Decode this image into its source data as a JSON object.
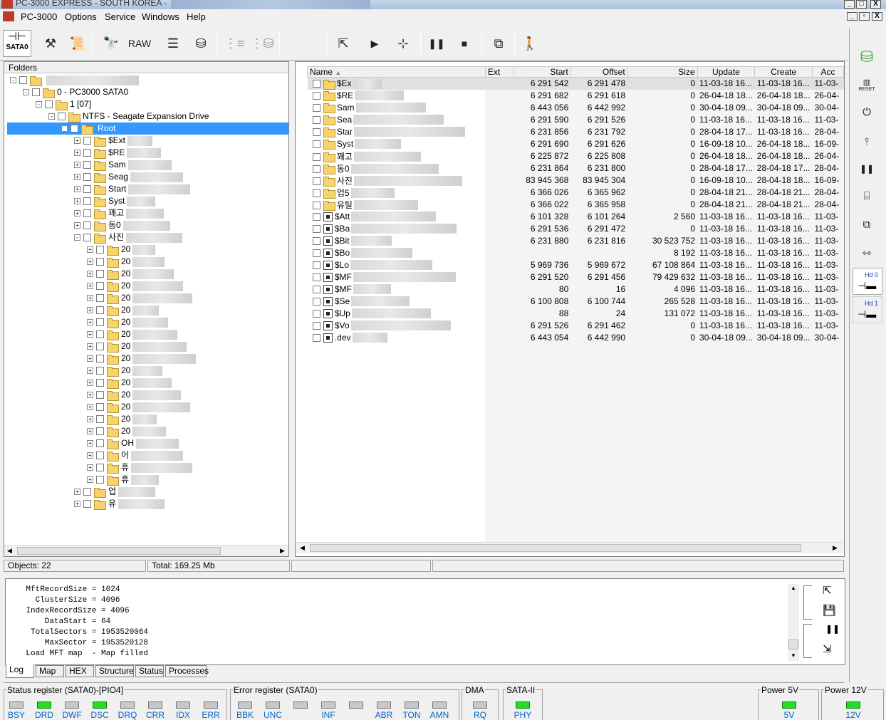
{
  "window": {
    "title": "PC-3000 EXPRESS - SOUTH KOREA -",
    "btn_min": "_",
    "btn_max": "□",
    "btn_close": "X",
    "child_min": "_",
    "child_restore": "▫",
    "child_close": "X"
  },
  "menu": [
    "PC-3000",
    "Options",
    "Service",
    "Windows",
    "Help"
  ],
  "toolbar": {
    "port_label": "SATA0",
    "raw_label": "RAW"
  },
  "folders": {
    "header": "Folders",
    "rows": [
      {
        "label": "",
        "level": 0,
        "exp": "-"
      },
      {
        "label": "0 - PC3000 SATA0",
        "level": 1,
        "exp": "-"
      },
      {
        "label": "1 [07]",
        "level": 2,
        "exp": "-"
      },
      {
        "label": "NTFS - Seagate Expansion Drive",
        "level": 3,
        "exp": "-"
      },
      {
        "label": "Root",
        "level": 4,
        "exp": "-"
      },
      {
        "label": "$Ext",
        "level": 5,
        "exp": "+"
      },
      {
        "label": "$RE",
        "level": 5,
        "exp": "+"
      },
      {
        "label": "Sam",
        "level": 5,
        "exp": "+"
      },
      {
        "label": "Seag",
        "level": 5,
        "exp": "+"
      },
      {
        "label": "Start",
        "level": 5,
        "exp": "+"
      },
      {
        "label": "Syst",
        "level": 5,
        "exp": "+"
      },
      {
        "label": "꽤고",
        "level": 5,
        "exp": "+"
      },
      {
        "label": "동0",
        "level": 5,
        "exp": "+"
      },
      {
        "label": "사진",
        "level": 5,
        "exp": "-"
      },
      {
        "label": "20",
        "level": 6,
        "exp": "+"
      },
      {
        "label": "20",
        "level": 6,
        "exp": "+"
      },
      {
        "label": "20",
        "level": 6,
        "exp": "+"
      },
      {
        "label": "20",
        "level": 6,
        "exp": "+"
      },
      {
        "label": "20",
        "level": 6,
        "exp": "+"
      },
      {
        "label": "20",
        "level": 6,
        "exp": "+"
      },
      {
        "label": "20",
        "level": 6,
        "exp": "+"
      },
      {
        "label": "20",
        "level": 6,
        "exp": "+"
      },
      {
        "label": "20",
        "level": 6,
        "exp": "+"
      },
      {
        "label": "20",
        "level": 6,
        "exp": "+"
      },
      {
        "label": "20",
        "level": 6,
        "exp": "+"
      },
      {
        "label": "20",
        "level": 6,
        "exp": "+"
      },
      {
        "label": "20",
        "level": 6,
        "exp": "+"
      },
      {
        "label": "20",
        "level": 6,
        "exp": "+"
      },
      {
        "label": "20",
        "level": 6,
        "exp": "+"
      },
      {
        "label": "20",
        "level": 6,
        "exp": "+"
      },
      {
        "label": "OH",
        "level": 6,
        "exp": "+"
      },
      {
        "label": "어",
        "level": 6,
        "exp": "+"
      },
      {
        "label": "휴",
        "level": 6,
        "exp": "+"
      },
      {
        "label": "휴",
        "level": 6,
        "exp": "+"
      },
      {
        "label": "업",
        "level": 5,
        "exp": "+"
      },
      {
        "label": "유",
        "level": 5,
        "exp": "+"
      }
    ]
  },
  "files": {
    "columns": [
      "Name",
      "Ext",
      "Start",
      "Offset",
      "Size",
      "Update",
      "Create",
      "Acc"
    ],
    "rows": [
      {
        "name": "$Ex",
        "type": "folder",
        "start": "6 291 542",
        "offset": "6 291 478",
        "size": "0",
        "update": "11-03-18 16...",
        "create": "11-03-18 16...",
        "acc": "11-03-"
      },
      {
        "name": "$RE",
        "type": "folder",
        "start": "6 291 682",
        "offset": "6 291 618",
        "size": "0",
        "update": "26-04-18 18...",
        "create": "26-04-18 18...",
        "acc": "26-04-"
      },
      {
        "name": "Sam",
        "type": "folder",
        "start": "6 443 056",
        "offset": "6 442 992",
        "size": "0",
        "update": "30-04-18 09...",
        "create": "30-04-18 09...",
        "acc": "30-04-"
      },
      {
        "name": "Sea",
        "type": "folder",
        "start": "6 291 590",
        "offset": "6 291 526",
        "size": "0",
        "update": "11-03-18 16...",
        "create": "11-03-18 16...",
        "acc": "11-03-"
      },
      {
        "name": "Star",
        "type": "folder",
        "start": "6 231 856",
        "offset": "6 231 792",
        "size": "0",
        "update": "28-04-18 17...",
        "create": "11-03-18 16...",
        "acc": "28-04-"
      },
      {
        "name": "Syst",
        "type": "folder",
        "start": "6 291 690",
        "offset": "6 291 626",
        "size": "0",
        "update": "16-09-18 10...",
        "create": "26-04-18 18...",
        "acc": "16-09-"
      },
      {
        "name": "꽤고",
        "type": "folder",
        "start": "6 225 872",
        "offset": "6 225 808",
        "size": "0",
        "update": "26-04-18 18...",
        "create": "26-04-18 18...",
        "acc": "26-04-"
      },
      {
        "name": "동0",
        "type": "folder",
        "start": "6 231 864",
        "offset": "6 231 800",
        "size": "0",
        "update": "28-04-18 17...",
        "create": "28-04-18 17...",
        "acc": "28-04-"
      },
      {
        "name": "사진",
        "type": "folder",
        "start": "83 945 368",
        "offset": "83 945 304",
        "size": "0",
        "update": "16-09-18 10...",
        "create": "28-04-18 18...",
        "acc": "16-09-"
      },
      {
        "name": "업5",
        "type": "folder",
        "start": "6 366 026",
        "offset": "6 365 962",
        "size": "0",
        "update": "28-04-18 21...",
        "create": "28-04-18 21...",
        "acc": "28-04-"
      },
      {
        "name": "유틸",
        "type": "folder",
        "start": "6 366 022",
        "offset": "6 365 958",
        "size": "0",
        "update": "28-04-18 21...",
        "create": "28-04-18 21...",
        "acc": "28-04-"
      },
      {
        "name": "$Att",
        "type": "file",
        "start": "6 101 328",
        "offset": "6 101 264",
        "size": "2 560",
        "update": "11-03-18 16...",
        "create": "11-03-18 16...",
        "acc": "11-03-"
      },
      {
        "name": "$Ba",
        "type": "file",
        "start": "6 291 536",
        "offset": "6 291 472",
        "size": "0",
        "update": "11-03-18 16...",
        "create": "11-03-18 16...",
        "acc": "11-03-"
      },
      {
        "name": "$Bit",
        "type": "file",
        "start": "6 231 880",
        "offset": "6 231 816",
        "size": "30 523 752",
        "update": "11-03-18 16...",
        "create": "11-03-18 16...",
        "acc": "11-03-"
      },
      {
        "name": "$Bo",
        "type": "file",
        "start": "",
        "offset": "",
        "size": "8 192",
        "update": "11-03-18 16...",
        "create": "11-03-18 16...",
        "acc": "11-03-"
      },
      {
        "name": "$Lo",
        "type": "file",
        "start": "5 969 736",
        "offset": "5 969 672",
        "size": "67 108 864",
        "update": "11-03-18 16...",
        "create": "11-03-18 16...",
        "acc": "11-03-"
      },
      {
        "name": "$MF",
        "type": "file",
        "start": "6 291 520",
        "offset": "6 291 456",
        "size": "79 429 632",
        "update": "11-03-18 16...",
        "create": "11-03-18 16...",
        "acc": "11-03-"
      },
      {
        "name": "$MF",
        "type": "file",
        "start": "80",
        "offset": "16",
        "size": "4 096",
        "update": "11-03-18 16...",
        "create": "11-03-18 16...",
        "acc": "11-03-"
      },
      {
        "name": "$Se",
        "type": "file",
        "start": "6 100 808",
        "offset": "6 100 744",
        "size": "265 528",
        "update": "11-03-18 16...",
        "create": "11-03-18 16...",
        "acc": "11-03-"
      },
      {
        "name": "$Up",
        "type": "file",
        "start": "88",
        "offset": "24",
        "size": "131 072",
        "update": "11-03-18 16...",
        "create": "11-03-18 16...",
        "acc": "11-03-"
      },
      {
        "name": "$Vo",
        "type": "file",
        "start": "6 291 526",
        "offset": "6 291 462",
        "size": "0",
        "update": "11-03-18 16...",
        "create": "11-03-18 16...",
        "acc": "11-03-"
      },
      {
        "name": ".dev",
        "type": "file",
        "start": "6 443 054",
        "offset": "6 442 990",
        "size": "0",
        "update": "30-04-18 09...",
        "create": "30-04-18 09...",
        "acc": "30-04-"
      }
    ]
  },
  "status": {
    "objects": "Objects: 22",
    "total": "Total: 169.25 Mb"
  },
  "log": {
    "lines": [
      "    MftRecordSize = 1024",
      "      ClusterSize = 4096",
      "    IndexRecordSize = 4096",
      "        DataStart = 64",
      "     TotalSectors = 1953520064",
      "        MaxSector = 1953520128",
      "    Load MFT map  - Map filled"
    ]
  },
  "tabs": [
    "Log",
    "Map",
    "HEX",
    "Structure",
    "Status",
    "Processes"
  ],
  "registers": {
    "status_title": "Status register (SATA0)-[PIO4]",
    "status_bits": [
      {
        "label": "BSY",
        "on": false
      },
      {
        "label": "DRD",
        "on": true
      },
      {
        "label": "DWF",
        "on": false
      },
      {
        "label": "DSC",
        "on": true
      },
      {
        "label": "DRQ",
        "on": false
      },
      {
        "label": "CRR",
        "on": false
      },
      {
        "label": "IDX",
        "on": false
      },
      {
        "label": "ERR",
        "on": false
      }
    ],
    "error_title": "Error register (SATA0)",
    "error_bits": [
      {
        "label": "BBK",
        "on": false
      },
      {
        "label": "UNC",
        "on": false
      },
      {
        "label": "",
        "on": false
      },
      {
        "label": "INF",
        "on": false
      },
      {
        "label": "",
        "on": false
      },
      {
        "label": "ABR",
        "on": false
      },
      {
        "label": "TON",
        "on": false
      },
      {
        "label": "AMN",
        "on": false
      }
    ],
    "dma_title": "DMA",
    "dma_bit": {
      "label": "RQ",
      "on": false
    },
    "sata_title": "SATA-II",
    "sata_bit": {
      "label": "PHY",
      "on": true
    },
    "p5_title": "Power 5V",
    "p5_bit": {
      "label": "5V",
      "on": true
    },
    "p12_title": "Power 12V",
    "p12_bit": {
      "label": "12V",
      "on": true
    }
  },
  "right_toolbar": {
    "reset_label": "RESET",
    "hd0_label": "Hd 0",
    "hd1_label": "Hd 1"
  },
  "colors": {
    "led_on": "#22dd22",
    "selection": "#3399ff"
  }
}
